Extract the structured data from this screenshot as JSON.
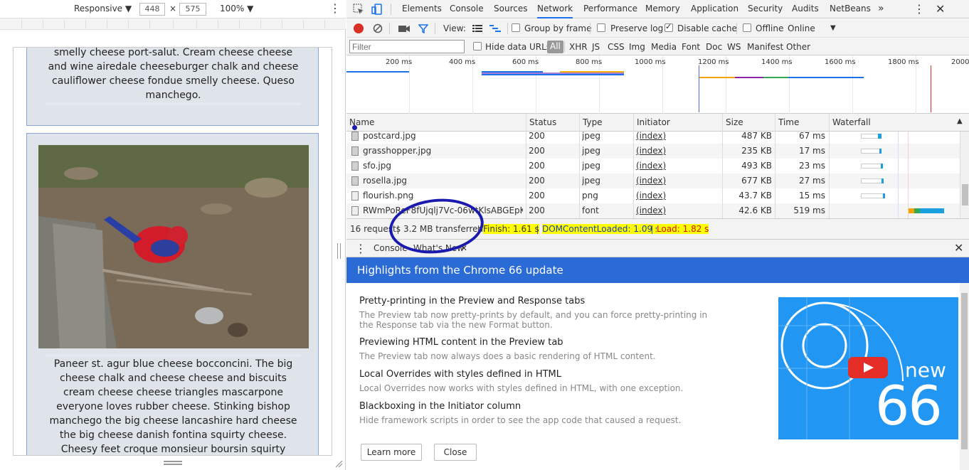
{
  "device_toolbar": {
    "mode": "Responsive",
    "width": "448",
    "times": "×",
    "height": "575",
    "zoom": "100%"
  },
  "page": {
    "top_card_text": "smelly cheese port-salut. Cream cheese cheese and wine airedale cheeseburger chalk and cheese cauliflower cheese fondue smelly cheese. Queso manchego.",
    "bottom_card_text": "Paneer st. agur blue cheese bocconcini. The big cheese chalk and cheese cheese and biscuits cream cheese cheese triangles mascarpone everyone loves rubber cheese. Stinking bishop manchego the big cheese lancashire hard cheese the big cheese danish fontina squirty cheese. Cheesy feet croque monsieur boursin squirty"
  },
  "devtools_tabs": [
    "Elements",
    "Console",
    "Sources",
    "Network",
    "Performance",
    "Memory",
    "Application",
    "Security",
    "Audits",
    "NetBeans"
  ],
  "active_tab": "Network",
  "network_toolbar": {
    "view_label": "View:",
    "group_by_frame": "Group by frame",
    "preserve_log": "Preserve log",
    "disable_cache": "Disable cache",
    "offline": "Offline",
    "throttle": "Online"
  },
  "filter_bar": {
    "placeholder": "Filter",
    "hide_data_urls": "Hide data URLs",
    "types": [
      "All",
      "XHR",
      "JS",
      "CSS",
      "Img",
      "Media",
      "Font",
      "Doc",
      "WS",
      "Manifest",
      "Other"
    ]
  },
  "overview": {
    "ticks": [
      "200 ms",
      "400 ms",
      "600 ms",
      "800 ms",
      "1000 ms",
      "1200 ms",
      "1400 ms",
      "1600 ms",
      "1800 ms",
      "2000"
    ]
  },
  "table": {
    "columns": [
      "Name",
      "Status",
      "Type",
      "Initiator",
      "Size",
      "Time",
      "Waterfall"
    ],
    "rows": [
      {
        "name": "postcard.jpg",
        "status": "200",
        "type": "jpeg",
        "initiator": "(index)",
        "size": "487 KB",
        "time": "67 ms",
        "icon": "image-file-icon"
      },
      {
        "name": "grasshopper.jpg",
        "status": "200",
        "type": "jpeg",
        "initiator": "(index)",
        "size": "235 KB",
        "time": "17 ms",
        "icon": "image-file-icon"
      },
      {
        "name": "sfo.jpg",
        "status": "200",
        "type": "jpeg",
        "initiator": "(index)",
        "size": "493 KB",
        "time": "23 ms",
        "icon": "image-file-icon"
      },
      {
        "name": "rosella.jpg",
        "status": "200",
        "type": "jpeg",
        "initiator": "(index)",
        "size": "677 KB",
        "time": "27 ms",
        "icon": "image-file-icon"
      },
      {
        "name": "flourish.png",
        "status": "200",
        "type": "png",
        "initiator": "(index)",
        "size": "43.7 KB",
        "time": "15 ms",
        "icon": "blank-file-icon"
      },
      {
        "name": "RWmPoReF8fUjqlj7Vc-06wtKlsABGEpKF...",
        "status": "200",
        "type": "font",
        "initiator": "(index)",
        "size": "42.6 KB",
        "time": "519 ms",
        "icon": "blank-file-icon"
      }
    ]
  },
  "summary": {
    "requests": "16 requests",
    "transferred": "3.2 MB transferred",
    "finish": "Finish: 1.61 s",
    "dom_content_loaded": "DOMContentLoaded: 1.09 s",
    "load": "Load: 1.82 s"
  },
  "drawer": {
    "tabs": [
      "Console",
      "What's New"
    ],
    "header": "Highlights from the Chrome 66 update",
    "items": [
      {
        "title": "Pretty-printing in the Preview and Response tabs",
        "desc": "The Preview tab now pretty-prints by default, and you can force pretty-printing in the Response tab via the new Format button."
      },
      {
        "title": "Previewing HTML content in the Preview tab",
        "desc": "The Preview tab now always does a basic rendering of HTML content."
      },
      {
        "title": "Local Overrides with styles defined in HTML",
        "desc": "Local Overrides now works with styles defined in HTML, with one exception."
      },
      {
        "title": "Blackboxing in the Initiator column",
        "desc": "Hide framework scripts in order to see the app code that caused a request."
      }
    ],
    "learn_more": "Learn more",
    "close": "Close",
    "promo_new": "new",
    "promo_version": "66"
  },
  "colors": {
    "accent": "#1a73e8",
    "whatsnew_header": "#2b6bd5",
    "promo_bg": "#2196f3",
    "annotation": "#1a1aae",
    "highlight": "#ffff00",
    "load_red": "#d3110f"
  }
}
